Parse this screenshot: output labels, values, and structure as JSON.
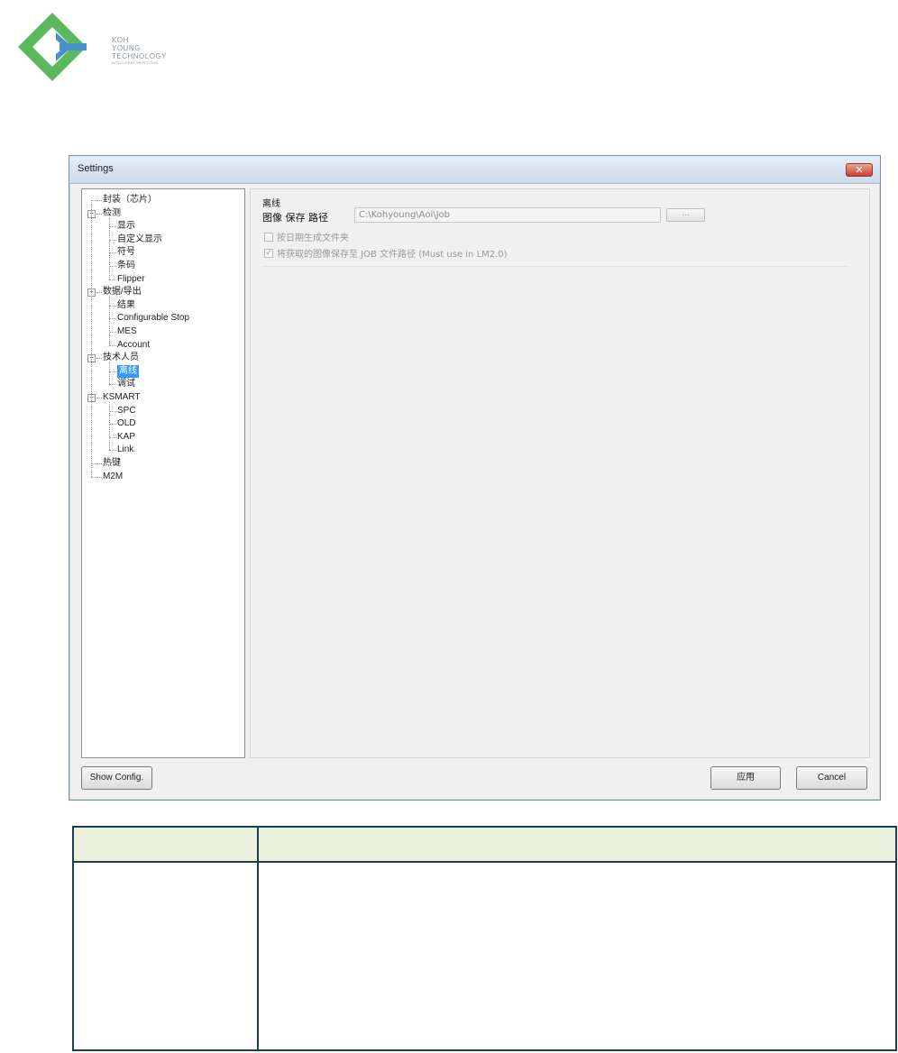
{
  "logo": {
    "lines": [
      "KOH",
      "YOUNG",
      "TECHNOLOGY"
    ],
    "tagline": "INTELLIGENT INSPECTION",
    "colors": {
      "diamond": "#5cb85c",
      "arrow": "#4a90c8"
    }
  },
  "dialog": {
    "title": "Settings",
    "close_label": "✕",
    "tree": [
      {
        "label": "封装（芯片）",
        "level": 0
      },
      {
        "label": "检测",
        "level": 0,
        "expander": "−"
      },
      {
        "label": "显示",
        "level": 1
      },
      {
        "label": "自定义显示",
        "level": 1
      },
      {
        "label": "符号",
        "level": 1
      },
      {
        "label": "条码",
        "level": 1
      },
      {
        "label": "Flipper",
        "level": 1
      },
      {
        "label": "数据/导出",
        "level": 0,
        "expander": "−"
      },
      {
        "label": "结果",
        "level": 1
      },
      {
        "label": "Configurable Stop",
        "level": 1
      },
      {
        "label": "MES",
        "level": 1
      },
      {
        "label": "Account",
        "level": 1
      },
      {
        "label": "技术人员",
        "level": 0,
        "expander": "−"
      },
      {
        "label": "离线",
        "level": 1,
        "selected": true
      },
      {
        "label": "调试",
        "level": 1
      },
      {
        "label": "KSMART",
        "level": 0,
        "expander": "−"
      },
      {
        "label": "SPC",
        "level": 1
      },
      {
        "label": "OLD",
        "level": 1
      },
      {
        "label": "KAP",
        "level": 1
      },
      {
        "label": "Link",
        "level": 1
      },
      {
        "label": "热键",
        "level": 0
      },
      {
        "label": "M2M",
        "level": 0
      }
    ],
    "panel": {
      "group_title": "离线",
      "path_label": "图像 保存 路径",
      "path_value": "C:\\Kohyoung\\Aoi\\Job",
      "browse_label": "...",
      "checkboxes": [
        {
          "label": "按日期生成文件夹",
          "checked": false
        },
        {
          "label": "将获取的图像保存至 JOB 文件路径 (Must use in LM2.0)",
          "checked": true
        }
      ]
    },
    "buttons": {
      "show_config": "Show Config.",
      "apply": "应用",
      "cancel": "Cancel"
    }
  },
  "table": {
    "header": [
      "",
      ""
    ],
    "rows": [
      [
        "",
        ""
      ]
    ]
  }
}
